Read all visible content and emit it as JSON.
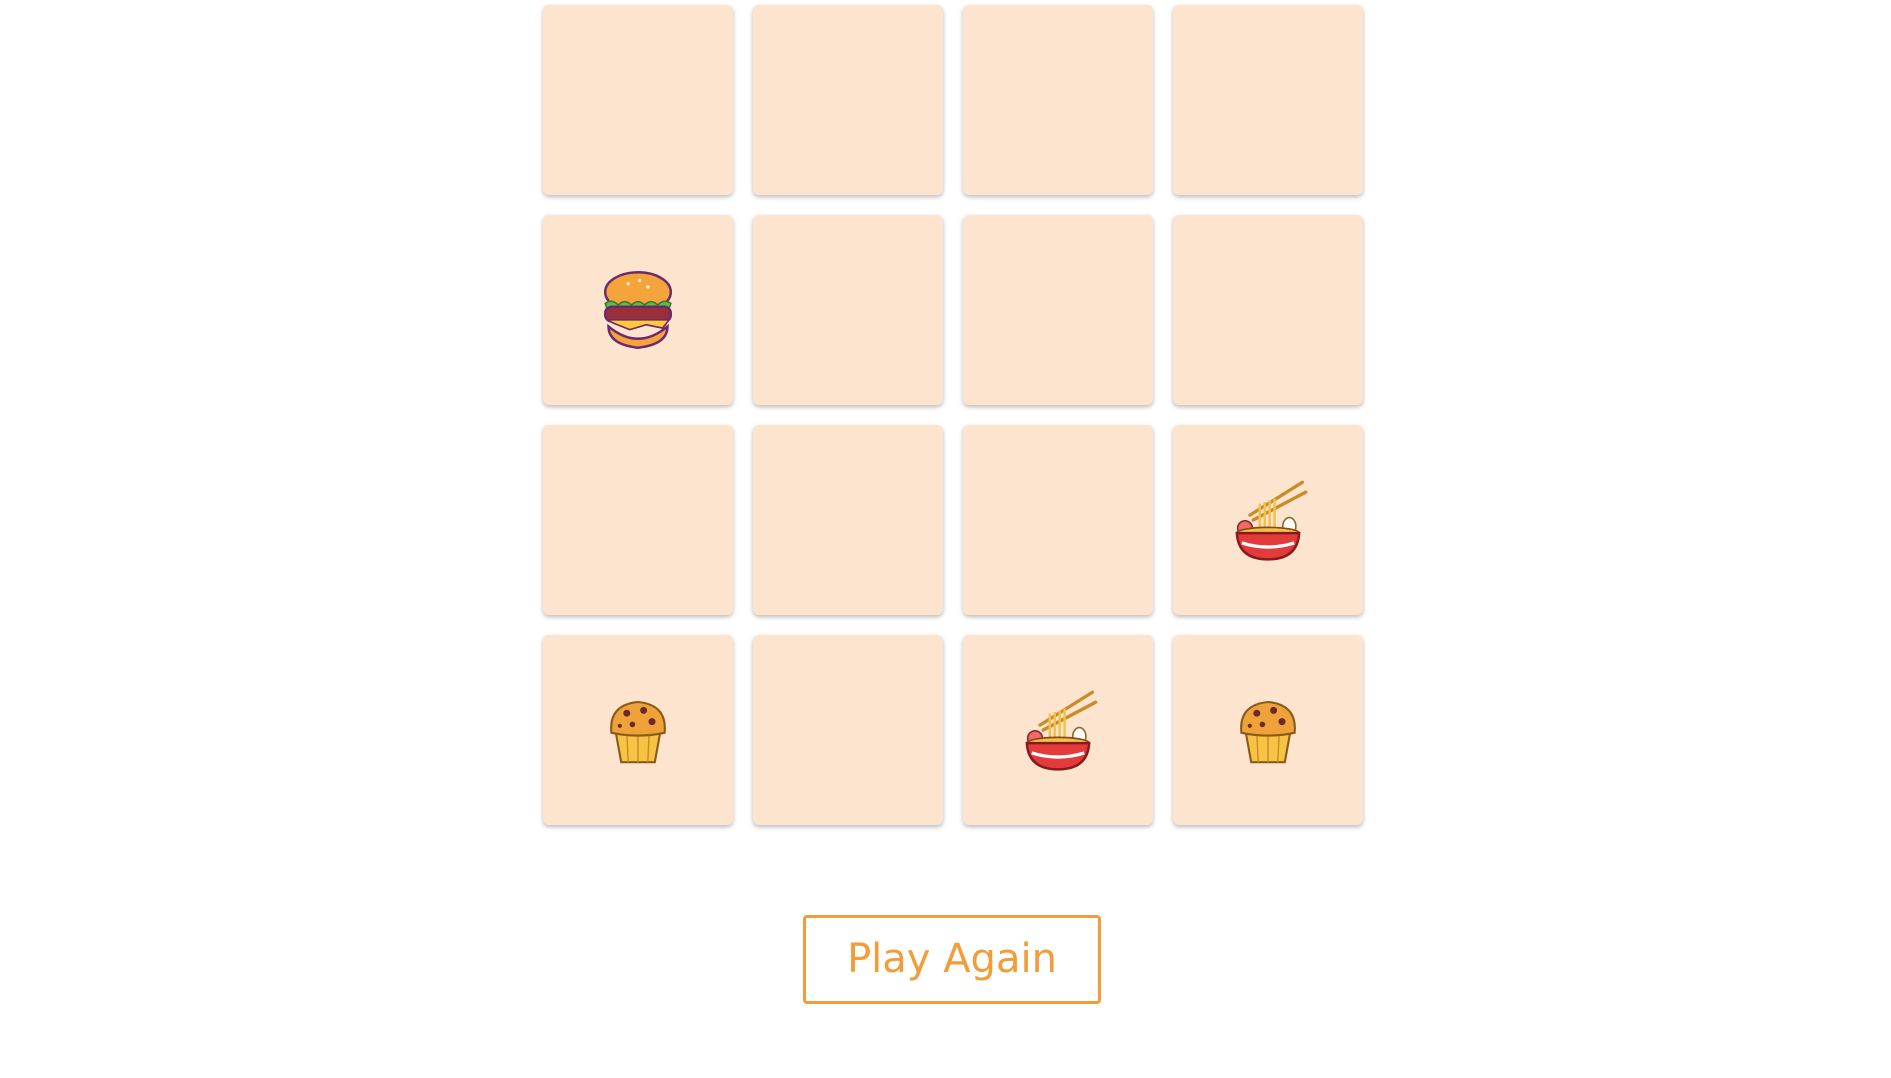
{
  "board": {
    "cards": [
      {
        "state": "face-down",
        "food": null
      },
      {
        "state": "face-down",
        "food": null
      },
      {
        "state": "face-down",
        "food": null
      },
      {
        "state": "face-down",
        "food": null
      },
      {
        "state": "face-up",
        "food": "burger-icon"
      },
      {
        "state": "face-down",
        "food": null
      },
      {
        "state": "face-down",
        "food": null
      },
      {
        "state": "face-down",
        "food": null
      },
      {
        "state": "face-down",
        "food": null
      },
      {
        "state": "face-down",
        "food": null
      },
      {
        "state": "face-down",
        "food": null
      },
      {
        "state": "face-up",
        "food": "ramen-icon"
      },
      {
        "state": "face-up",
        "food": "muffin-icon"
      },
      {
        "state": "face-down",
        "food": null
      },
      {
        "state": "face-up",
        "food": "ramen-icon"
      },
      {
        "state": "face-up",
        "food": "muffin-icon"
      }
    ],
    "card_color": "#fde4ce"
  },
  "controls": {
    "play_again_label": "Play Again",
    "accent_color": "#f39c3a"
  }
}
